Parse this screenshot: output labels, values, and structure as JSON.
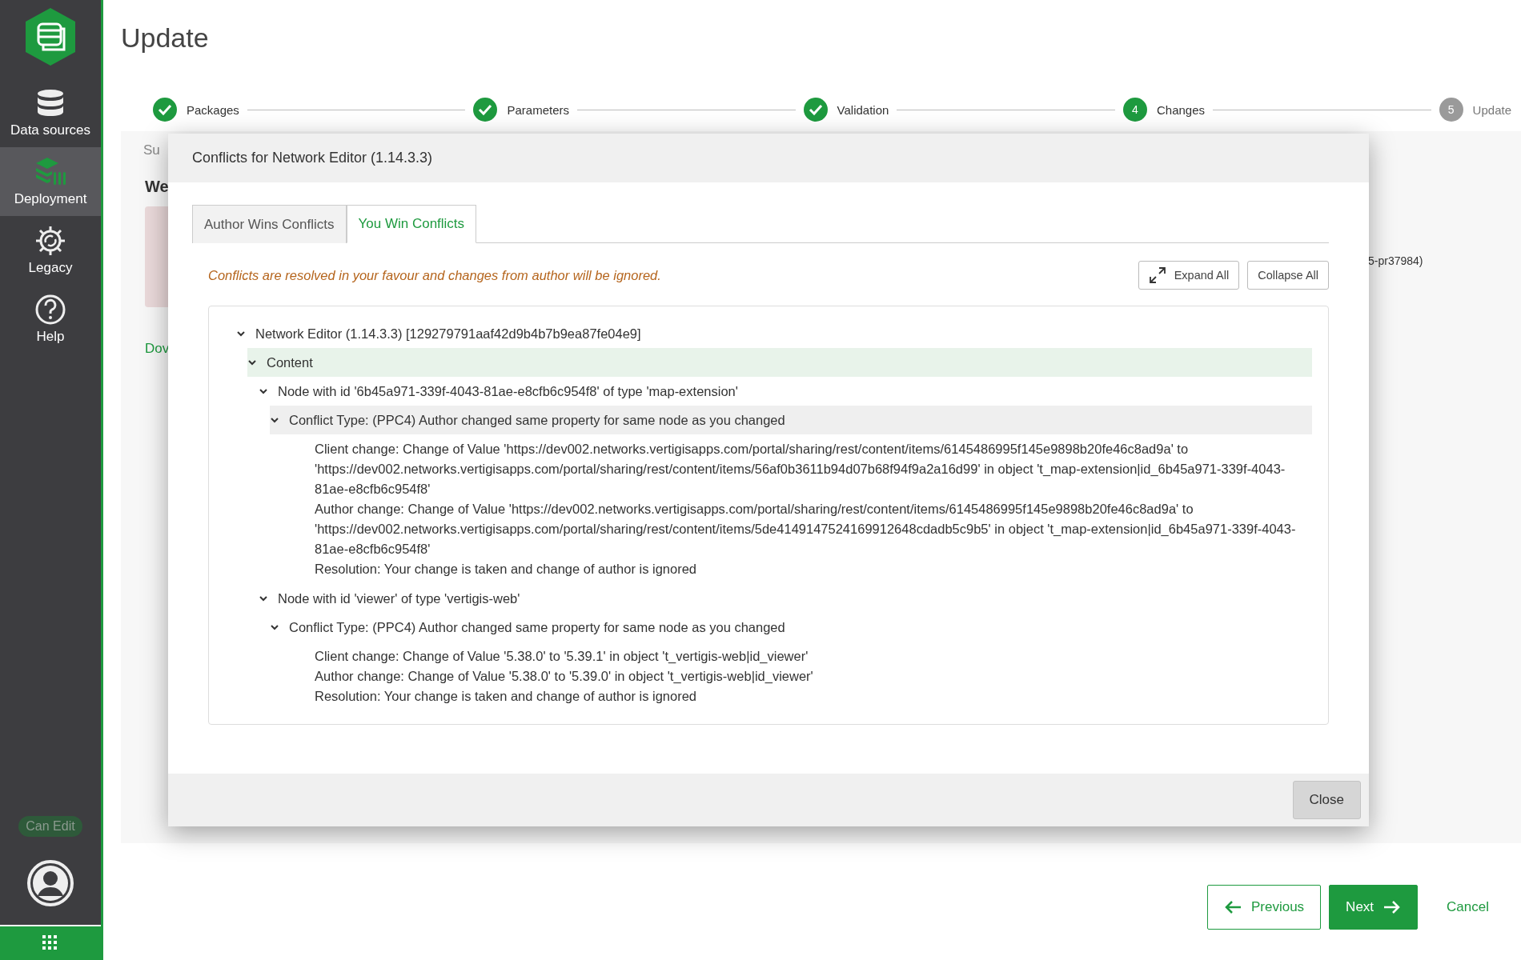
{
  "sidebar": {
    "items": [
      {
        "label": "Data sources",
        "kind": "database",
        "selected": false
      },
      {
        "label": "Deployment",
        "kind": "deployment",
        "selected": true
      },
      {
        "label": "Legacy",
        "kind": "legacy",
        "selected": false
      },
      {
        "label": "Help",
        "kind": "help",
        "selected": false
      }
    ],
    "badge": "Can Edit"
  },
  "page": {
    "title": "Update",
    "steps": [
      {
        "label": "Packages",
        "kind": "done"
      },
      {
        "label": "Parameters",
        "kind": "done"
      },
      {
        "label": "Validation",
        "kind": "done"
      },
      {
        "label": "Changes",
        "kind": "current",
        "number": "4"
      },
      {
        "label": "Update",
        "kind": "pending",
        "number": "5"
      }
    ],
    "behind": {
      "summary": "Su",
      "heading": "We",
      "link": "Dov",
      "version": "5-pr37984)"
    },
    "buttons": {
      "previous": "Previous",
      "next": "Next",
      "cancel": "Cancel"
    }
  },
  "dialog": {
    "title": "Conflicts for Network Editor (1.14.3.3)",
    "tabs": [
      {
        "label": "Author Wins Conflicts",
        "selected": false
      },
      {
        "label": "You Win Conflicts",
        "selected": true
      }
    ],
    "message": "Conflicts are resolved in your favour and changes from author will be ignored.",
    "expand_all": "Expand All",
    "collapse_all": "Collapse All",
    "tree": [
      {
        "label": "Network Editor (1.14.3.3) [129279791aaf42d9b4b7b9ea87fe04e9]",
        "expanded": true,
        "selected": false,
        "hovered": false,
        "children": [
          {
            "label": "Content",
            "expanded": true,
            "selected": true,
            "hovered": false,
            "children": [
              {
                "label": "Node with id '6b45a971-339f-4043-81ae-e8cfb6c954f8' of type 'map-extension'",
                "expanded": true,
                "selected": false,
                "hovered": false,
                "children": [
                  {
                    "label": "Conflict Type: (PPC4) Author changed same property for same node as you changed",
                    "expanded": true,
                    "selected": false,
                    "hovered": true,
                    "details": [
                      "Client change: Change of Value 'https://dev002.networks.vertigisapps.com/portal/sharing/rest/content/items/6145486995f145e9898b20fe46c8ad9a' to 'https://dev002.networks.vertigisapps.com/portal/sharing/rest/content/items/56af0b3611b94d07b68f94f9a2a16d99' in object 't_map-extension|id_6b45a971-339f-4043-81ae-e8cfb6c954f8'",
                      "Author change: Change of Value 'https://dev002.networks.vertigisapps.com/portal/sharing/rest/content/items/6145486995f145e9898b20fe46c8ad9a' to 'https://dev002.networks.vertigisapps.com/portal/sharing/rest/content/items/5de4149147524169912648cdadb5c9b5' in object 't_map-extension|id_6b45a971-339f-4043-81ae-e8cfb6c954f8'",
                      "Resolution: Your change is taken and change of author is ignored"
                    ]
                  }
                ]
              },
              {
                "label": "Node with id 'viewer' of type 'vertigis-web'",
                "expanded": true,
                "selected": false,
                "hovered": false,
                "children": [
                  {
                    "label": "Conflict Type: (PPC4) Author changed same property for same node as you changed",
                    "expanded": true,
                    "selected": false,
                    "hovered": false,
                    "details": [
                      "Client change: Change of Value '5.38.0' to '5.39.1' in object 't_vertigis-web|id_viewer'",
                      "Author change: Change of Value '5.38.0' to '5.39.0' in object 't_vertigis-web|id_viewer'",
                      "Resolution: Your change is taken and change of author is ignored"
                    ]
                  }
                ]
              }
            ]
          }
        ]
      }
    ],
    "close": "Close"
  }
}
